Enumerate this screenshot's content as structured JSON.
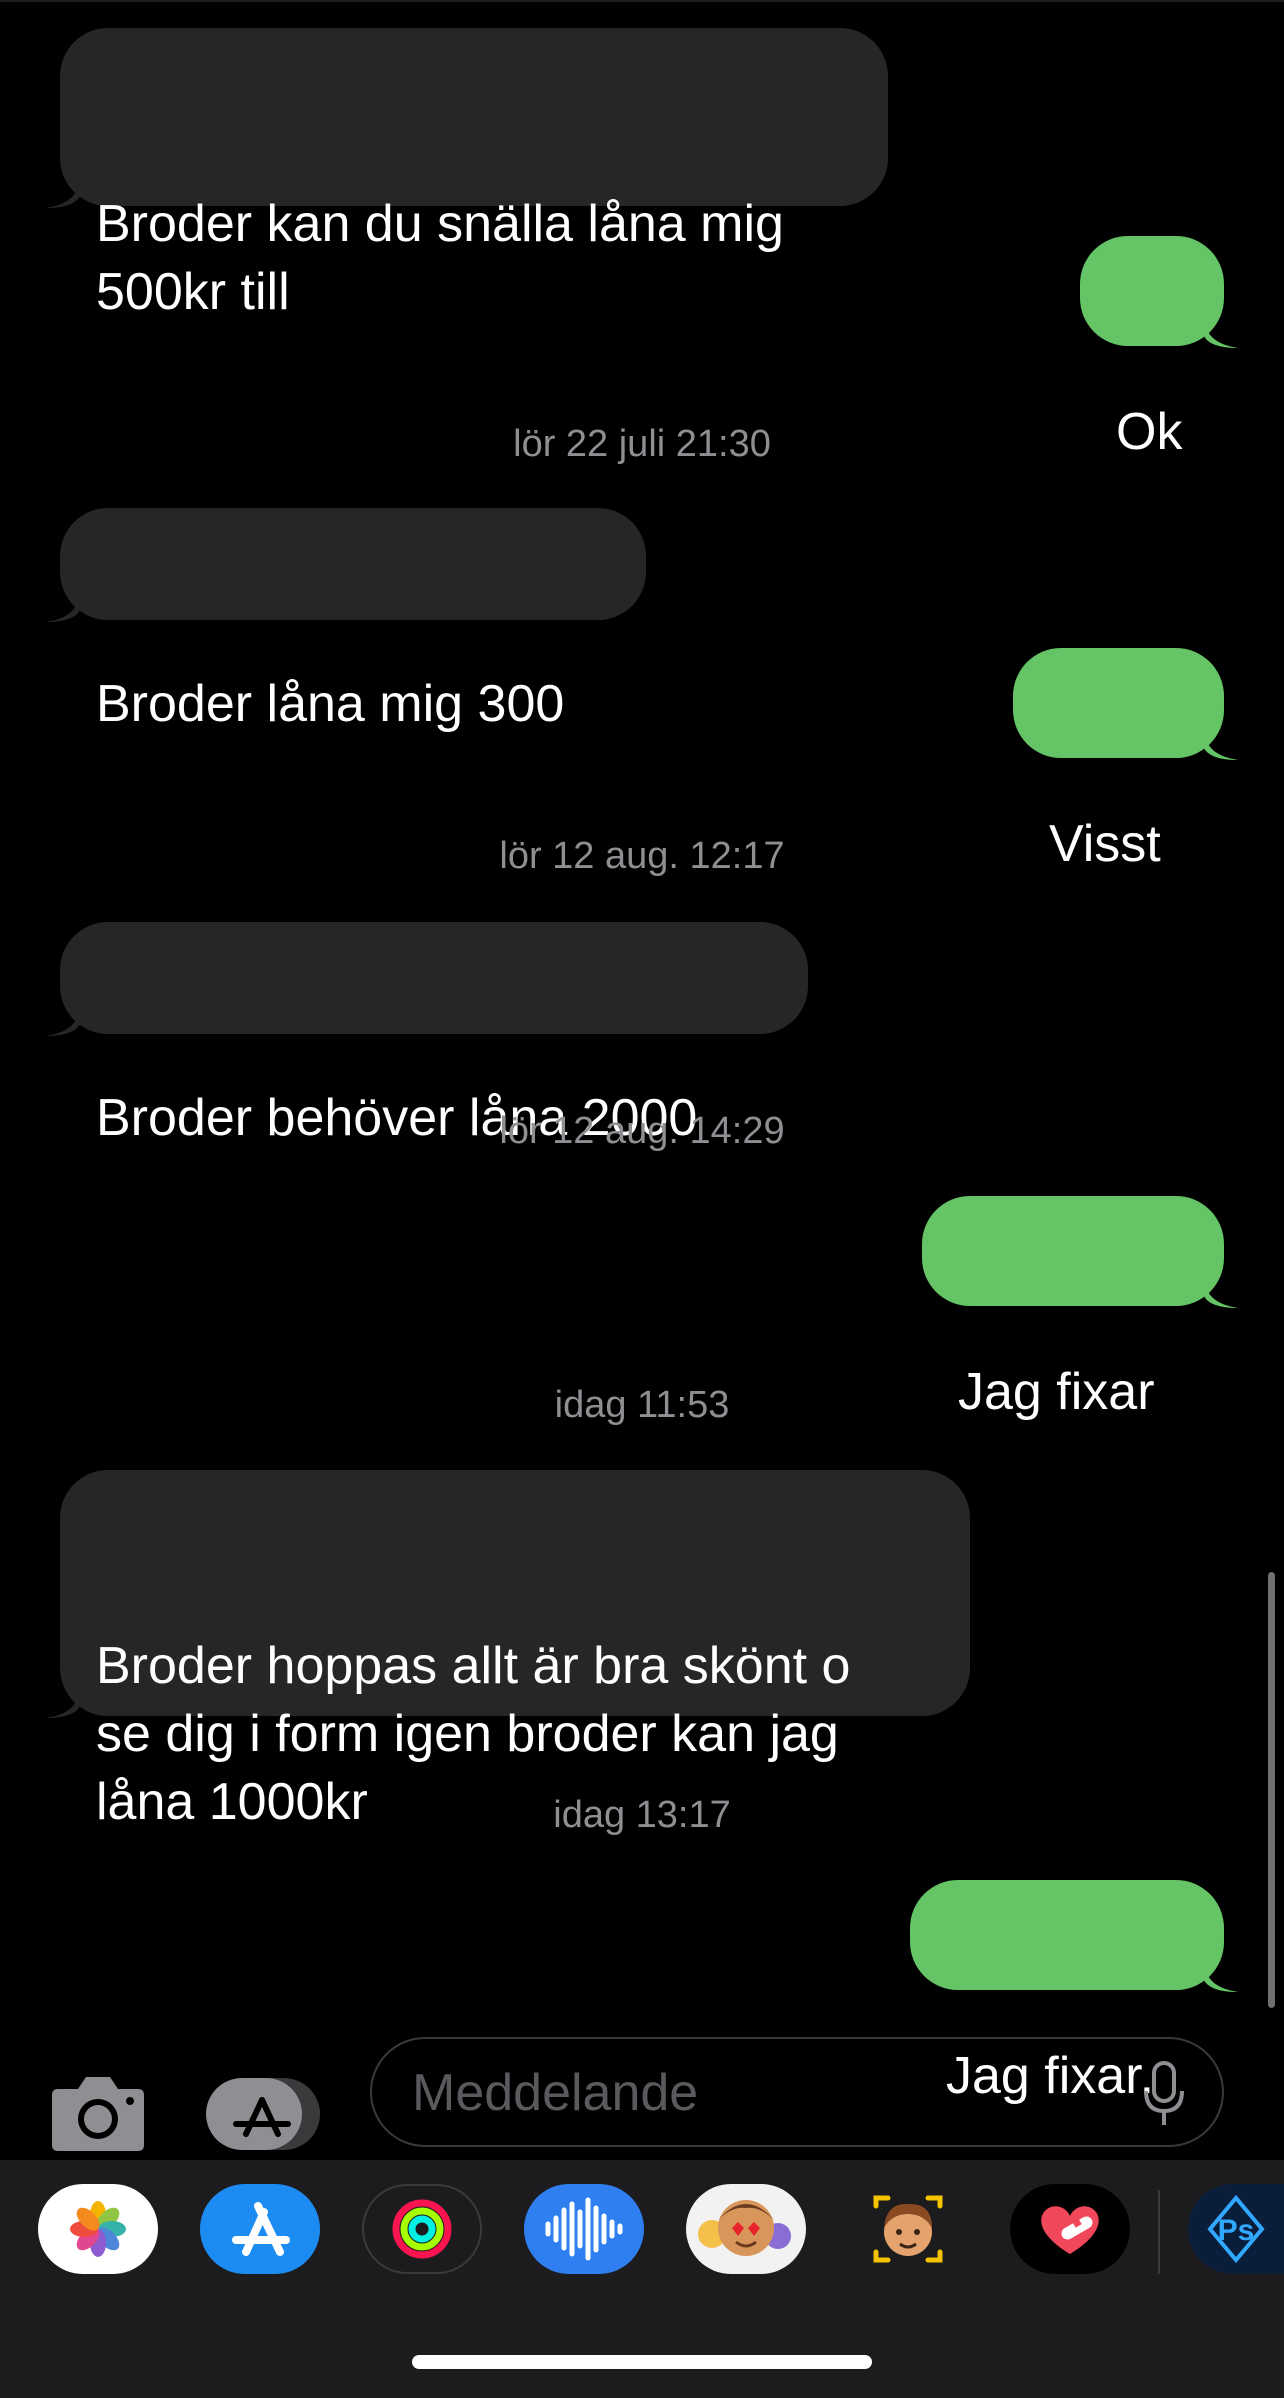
{
  "messages": [
    {
      "dir": "in",
      "text": "Broder kan du snälla låna mig\n500kr till"
    },
    {
      "dir": "out",
      "text": "Ok"
    },
    {
      "dir": "in",
      "text": "Broder låna mig 300"
    },
    {
      "dir": "out",
      "text": "Visst"
    },
    {
      "dir": "in",
      "text": "Broder behöver låna 2000"
    },
    {
      "dir": "out",
      "text": "Jag fixar"
    },
    {
      "dir": "in",
      "text": "Broder hoppas allt är bra skönt o\nse dig i form igen broder kan jag\nlåna 1000kr"
    },
    {
      "dir": "out",
      "text": "Jag fixar."
    }
  ],
  "timestamps": [
    "lör 22 juli 21:30",
    "lör 12 aug. 12:17",
    "lör 12 aug. 14:29",
    "idag 11:53",
    "idag 13:17"
  ],
  "compose": {
    "placeholder": "Meddelande"
  },
  "app_tray": [
    "photos-app",
    "app-store-app",
    "fitness-app",
    "voice-memos-app",
    "animoji-stickers-app",
    "memoji-app",
    "heart-stickers-app",
    "photoshop-express-app"
  ],
  "colors": {
    "incoming": "#262628",
    "outgoing": "#65c466",
    "background": "#000000"
  }
}
